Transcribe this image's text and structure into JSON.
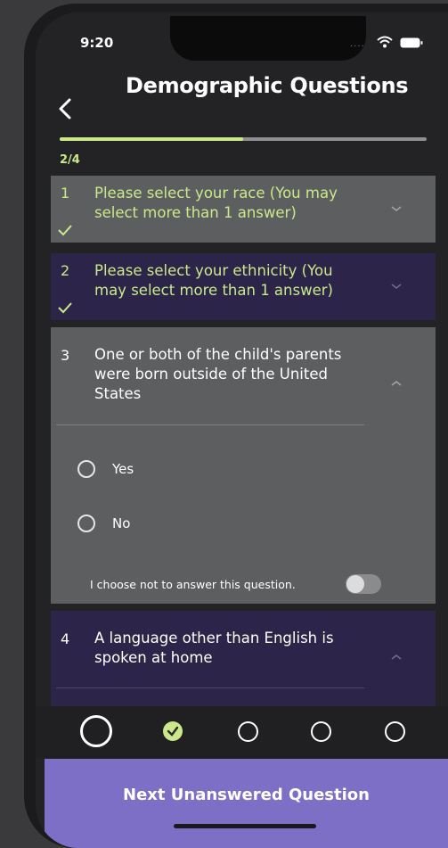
{
  "status_bar": {
    "time": "9:20",
    "signal": "....",
    "wifi": "wifi-icon",
    "battery": "battery-icon"
  },
  "header": {
    "title": "Demographic Questions",
    "back_icon": "chevron-left-icon"
  },
  "progress": {
    "fraction": 0.5,
    "label": "2/4",
    "fill_color": "#cbe98a"
  },
  "questions": [
    {
      "number": "1",
      "text": "Please select your race (You may select more than 1 answer)",
      "answered": true,
      "expanded": false
    },
    {
      "number": "2",
      "text": "Please select your ethnicity (You may select more than 1 answer)",
      "answered": true,
      "expanded": false
    },
    {
      "number": "3",
      "text": "One or both of the child's parents were born outside of the United States",
      "answered": false,
      "expanded": true,
      "options": [
        {
          "label": "Yes",
          "selected": false
        },
        {
          "label": "No",
          "selected": false
        }
      ],
      "decline_label": "I choose not to answer this question.",
      "decline_on": false
    },
    {
      "number": "4",
      "text": "A language other than English is spoken at home",
      "answered": false,
      "expanded": true
    }
  ],
  "navigator": {
    "dots": [
      "current",
      "answered",
      "unanswered",
      "unanswered",
      "unanswered"
    ]
  },
  "next_button": {
    "label": "Next Unanswered Question",
    "color": "#7e6fc6"
  },
  "colors": {
    "accent": "#cbe98a",
    "card_gray": "#5d5e5f",
    "card_purple": "#2c2549"
  }
}
